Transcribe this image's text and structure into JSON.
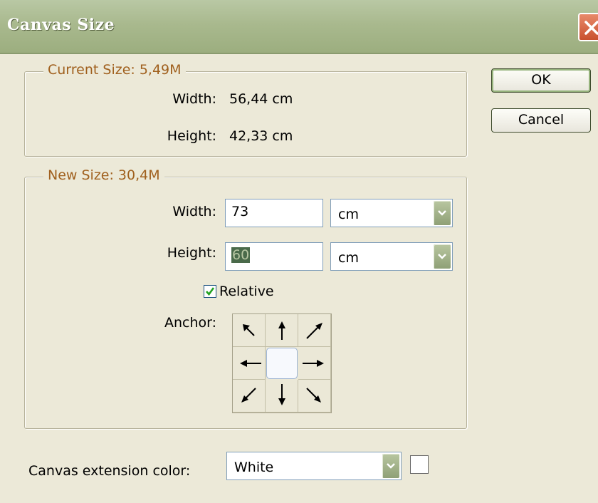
{
  "window": {
    "title": "Canvas Size"
  },
  "buttons": {
    "ok_label": "OK",
    "cancel_label": "Cancel"
  },
  "current_size": {
    "legend": "Current Size: 5,49M",
    "width_label": "Width:",
    "width_value": "56,44 cm",
    "height_label": "Height:",
    "height_value": "42,33 cm"
  },
  "new_size": {
    "legend": "New Size: 30,4M",
    "width_label": "Width:",
    "width_value": "73",
    "width_unit": "cm",
    "height_label": "Height:",
    "height_value": "60",
    "height_unit": "cm",
    "relative_label": "Relative",
    "relative_checked": true,
    "anchor_label": "Anchor:",
    "anchor_selected": "center"
  },
  "extension": {
    "label": "Canvas extension color:",
    "value": "White",
    "swatch_color": "#ffffff"
  },
  "colors": {
    "title_bar": "#a9b98e",
    "legend_text": "#a0601e",
    "dialog_bg": "#ece9d8",
    "close_button": "#d9603e"
  }
}
